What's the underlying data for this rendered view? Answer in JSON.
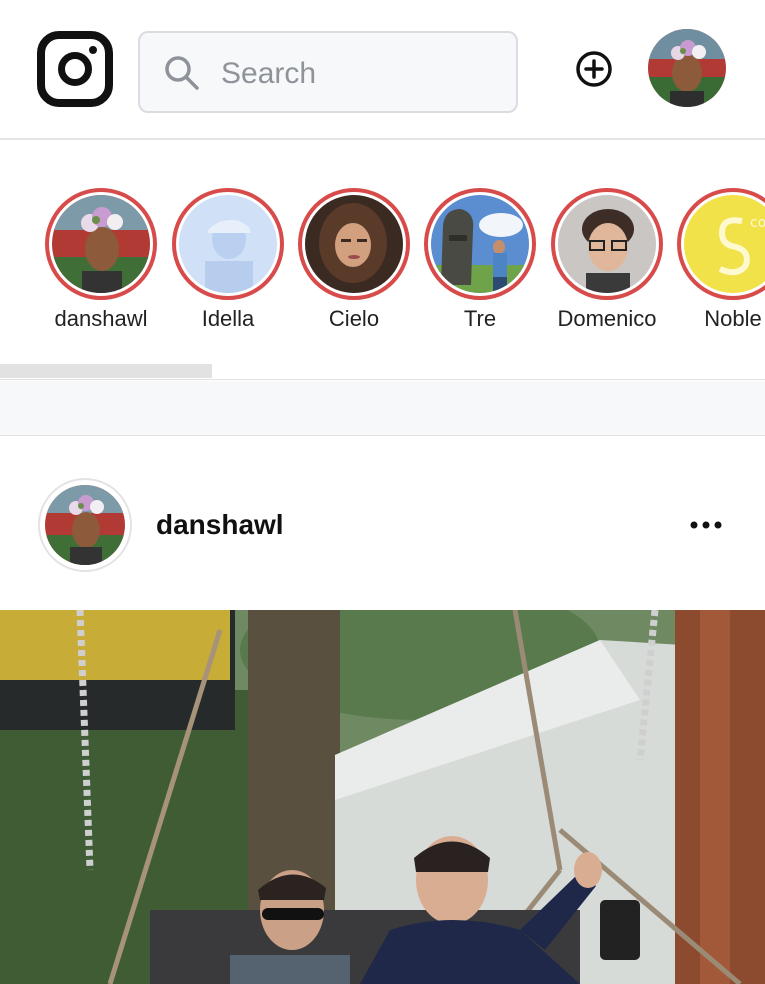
{
  "header": {
    "logo": "instagram-logo",
    "search_placeholder": "Search",
    "add_icon": "plus-circle-icon",
    "profile_avatar": "user-avatar"
  },
  "stories": [
    {
      "name": "danshawl"
    },
    {
      "name": "Idella"
    },
    {
      "name": "Cielo"
    },
    {
      "name": "Tre"
    },
    {
      "name": "Domenico"
    },
    {
      "name": "Noble"
    }
  ],
  "post": {
    "username": "danshawl",
    "more_icon": "more-horizontal-icon"
  },
  "colors": {
    "story_ring": "#d84b4b",
    "search_bg": "#f7f8fa",
    "divider": "#e1e1e1"
  }
}
